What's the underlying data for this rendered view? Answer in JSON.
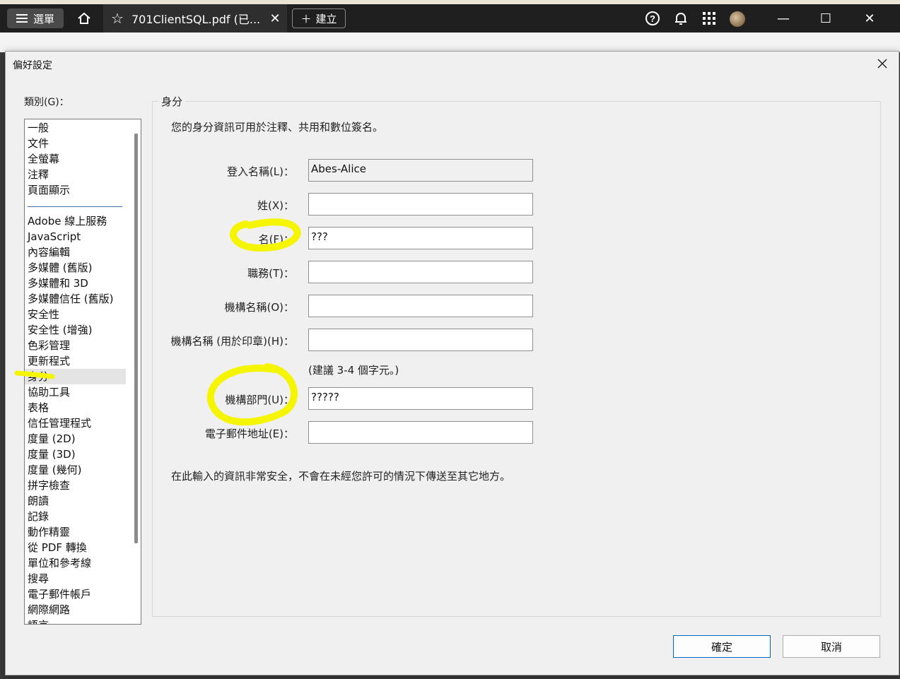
{
  "app": {
    "menu_label": "選單",
    "tab_title": "701ClientSQL.pdf (已...",
    "new_label": "建立"
  },
  "dialog": {
    "title": "偏好設定",
    "category_label": "類別(G)：",
    "categories_top": [
      "一般",
      "文件",
      "全螢幕",
      "注釋",
      "頁面顯示"
    ],
    "categories": [
      "Adobe 線上服務",
      "JavaScript",
      "內容編輯",
      "多媒體 (舊版)",
      "多媒體和 3D",
      "多媒體信任 (舊版)",
      "安全性",
      "安全性 (增強)",
      "色彩管理",
      "更新程式",
      "身分",
      "協助工具",
      "表格",
      "信任管理程式",
      "度量 (2D)",
      "度量 (3D)",
      "度量 (幾何)",
      "拼字檢查",
      "朗讀",
      "記錄",
      "動作精靈",
      "從 PDF 轉換",
      "單位和參考線",
      "搜尋",
      "電子郵件帳戶",
      "網際網路",
      "語言"
    ],
    "selected_category": "身分",
    "section_title": "身分",
    "intro": "您的身分資訊可用於注釋、共用和數位簽名。",
    "fields": {
      "login": {
        "label": "登入名稱(L)：",
        "value": "Abes-Alice"
      },
      "last_name": {
        "label": "姓(X)：",
        "value": ""
      },
      "first_name": {
        "label": "名(F)：",
        "value": "???"
      },
      "title": {
        "label": "職務(T)：",
        "value": ""
      },
      "org": {
        "label": "機構名稱(O)：",
        "value": ""
      },
      "org_short": {
        "label": "機構名稱 (用於印章)(H)：",
        "value": ""
      },
      "dept": {
        "label": "機構部門(U)：",
        "value": "?????"
      },
      "email": {
        "label": "電子郵件地址(E)：",
        "value": ""
      }
    },
    "hint": "(建議 3-4 個字元。)",
    "security_note": "在此輸入的資訊非常安全，不會在未經您許可的情況下傳送至其它地方。",
    "ok_label": "確定",
    "cancel_label": "取消"
  },
  "colors": {
    "highlight": "#f5f500",
    "primary_border": "#0067c0"
  }
}
